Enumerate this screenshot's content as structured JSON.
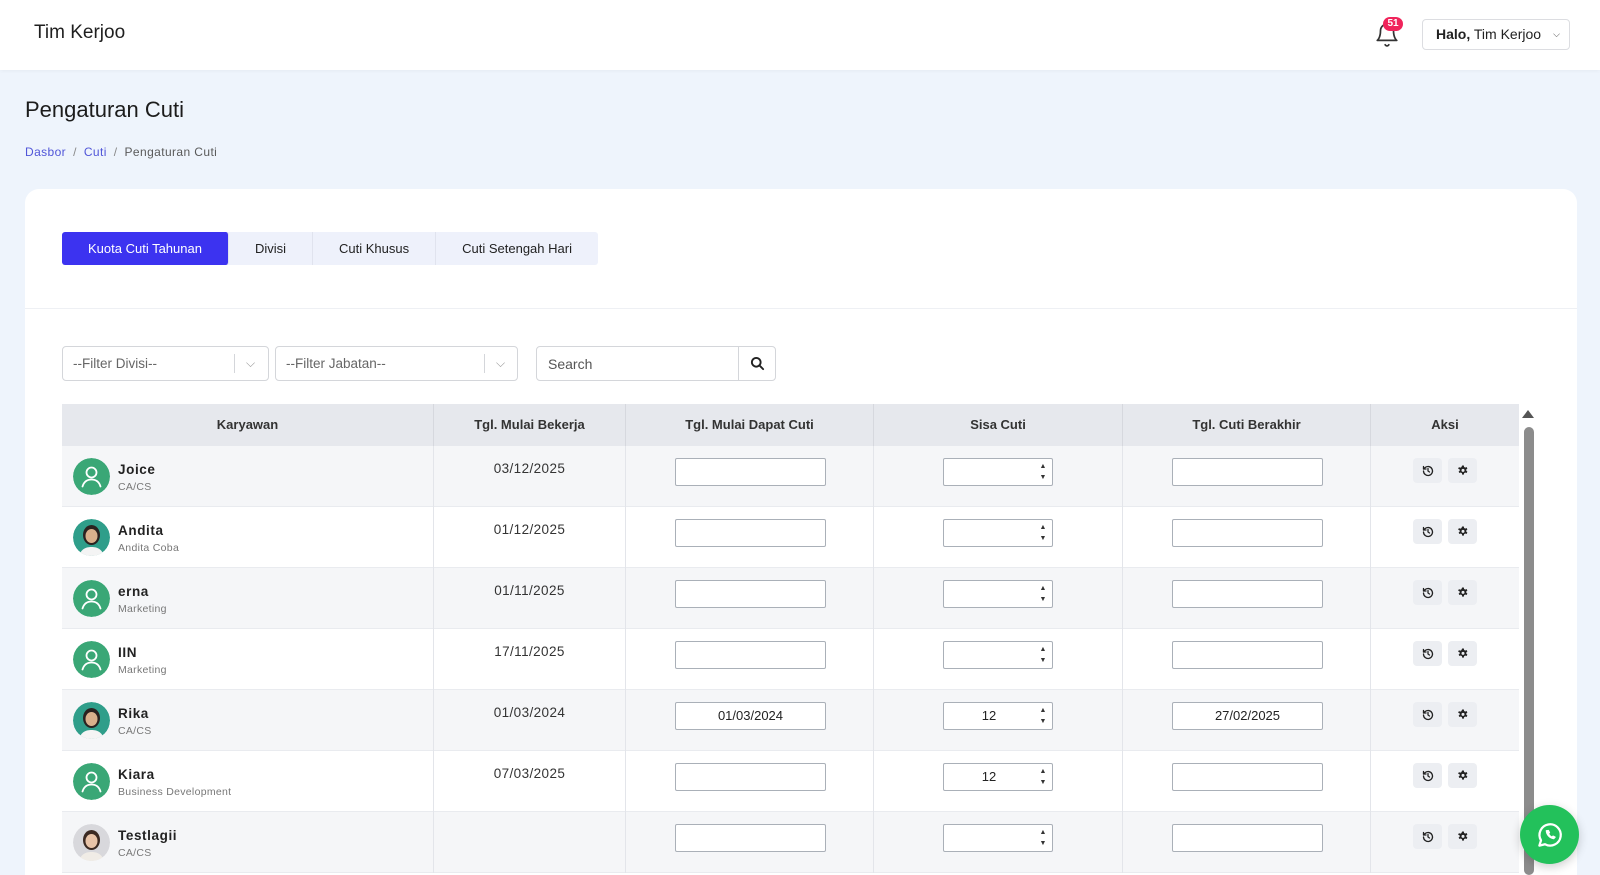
{
  "header": {
    "brand": "Tim Kerjoo",
    "notification_count": "51",
    "greeting_bold": "Halo,",
    "user_name": " Tim Kerjoo"
  },
  "page": {
    "title": "Pengaturan Cuti",
    "breadcrumb": [
      {
        "label": "Dasbor"
      },
      {
        "label": "Cuti"
      },
      {
        "label": "Pengaturan Cuti"
      }
    ]
  },
  "tabs": [
    {
      "label": "Kuota Cuti Tahunan",
      "active": true
    },
    {
      "label": "Divisi"
    },
    {
      "label": "Cuti Khusus"
    },
    {
      "label": "Cuti Setengah Hari"
    }
  ],
  "filters": {
    "divisi_placeholder": "--Filter Divisi--",
    "jabatan_placeholder": "--Filter Jabatan--",
    "search_placeholder": "Search"
  },
  "table": {
    "columns": [
      "Karyawan",
      "Tgl. Mulai Bekerja",
      "Tgl. Mulai Dapat Cuti",
      "Sisa Cuti",
      "Tgl. Cuti Berakhir",
      "Aksi"
    ],
    "rows": [
      {
        "name": "Joice",
        "role": "CA/CS",
        "avatar": "default",
        "start_date": "03/12/2025",
        "leave_start": "",
        "remaining": "",
        "leave_end": ""
      },
      {
        "name": "Andita",
        "role": "Andita Coba",
        "avatar": "photo",
        "start_date": "01/12/2025",
        "leave_start": "",
        "remaining": "",
        "leave_end": ""
      },
      {
        "name": "erna",
        "role": "Marketing",
        "avatar": "default",
        "start_date": "01/11/2025",
        "leave_start": "",
        "remaining": "",
        "leave_end": ""
      },
      {
        "name": "IIN",
        "role": "Marketing",
        "avatar": "default",
        "start_date": "17/11/2025",
        "leave_start": "",
        "remaining": "",
        "leave_end": ""
      },
      {
        "name": "Rika",
        "role": "CA/CS",
        "avatar": "photo",
        "start_date": "01/03/2024",
        "leave_start": "01/03/2024",
        "remaining": "12",
        "leave_end": "27/02/2025"
      },
      {
        "name": "Kiara",
        "role": "Business Development",
        "avatar": "default",
        "start_date": "07/03/2025",
        "leave_start": "",
        "remaining": "12",
        "leave_end": ""
      },
      {
        "name": "Testlagii",
        "role": "CA/CS",
        "avatar": "photo",
        "start_date": "",
        "leave_start": "",
        "remaining": "",
        "leave_end": ""
      }
    ]
  },
  "colors": {
    "accent": "#3c33f0",
    "badge": "#f0245b",
    "avatar_default": "#3aa776",
    "whatsapp": "#23c15b"
  },
  "icons": {
    "notification": "bell-icon",
    "search": "search-icon",
    "history": "history-icon",
    "settings": "gear-icon",
    "whatsapp": "whatsapp-icon"
  }
}
